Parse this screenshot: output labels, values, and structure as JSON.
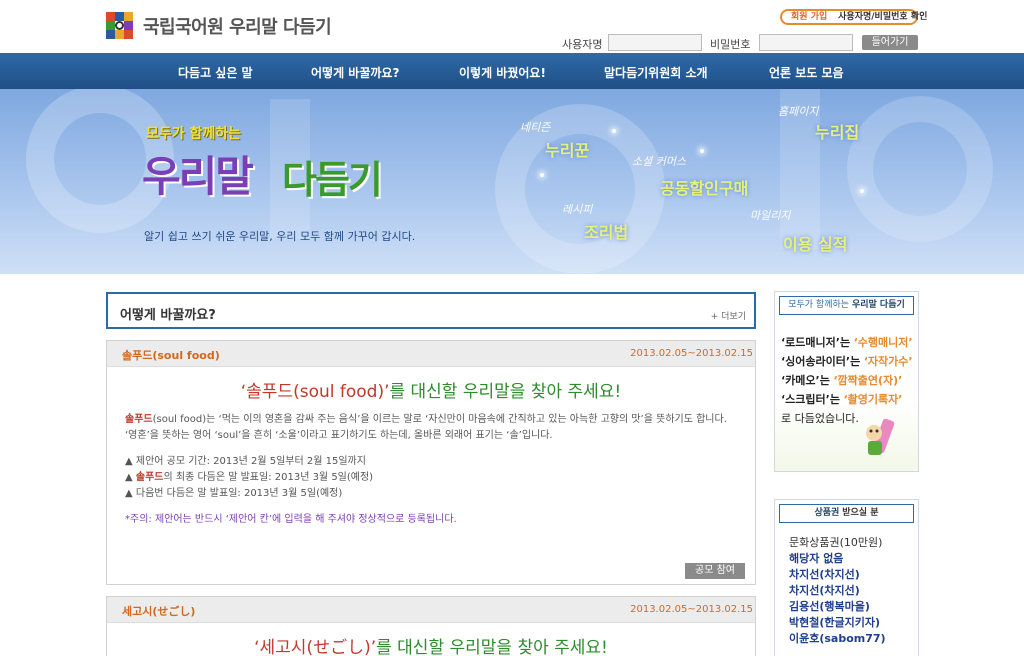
{
  "header": {
    "site_title": "국립국어원 우리말 다듬기",
    "member_join": "회원 가입",
    "find_account": "사용자명/비밀번호 확인",
    "username_label": "사용자명",
    "password_label": "비밀번호",
    "login_button": "들어가기"
  },
  "nav": {
    "items": [
      "다듬고 싶은 말",
      "어떻게 바꿀까요?",
      "이렇게 바꿨어요!",
      "말다듬기위원회 소개",
      "언론 보도 모음"
    ]
  },
  "banner": {
    "subtitle": "모두가 함께하는",
    "title_part1": "우리말",
    "title_part2": "다듬기",
    "slogan": "알기 쉽고 쓰기 쉬운 우리말, 우리 모두 함께 가꾸어 갑시다.",
    "keywords": [
      {
        "original": "네티즌",
        "replacement": "누리꾼"
      },
      {
        "original": "홈페이지",
        "replacement": "누리집"
      },
      {
        "original": "소셜 커머스",
        "replacement": "공동할인구매"
      },
      {
        "original": "레시피",
        "replacement": "조리법"
      },
      {
        "original": "마일리지",
        "replacement": "이용 실적"
      }
    ]
  },
  "section": {
    "title": "어떻게 바꿀까요?",
    "more": "+ 더보기"
  },
  "cards": [
    {
      "name": "솔푸드(soul food)",
      "date": "2013.02.05~2013.02.15",
      "headline_quoted": "‘솔푸드(soul food)’",
      "headline_rest": "를 대신할 우리말을 찾아 주세요!",
      "desc_term": "솔푸드",
      "desc_rest": "(soul food)는 ‘먹는 이의 영혼을 감싸 주는 음식’을 이르는 말로 ‘자신만이 마음속에 간직하고 있는 아늑한 고향의 맛’을 뜻하기도 합니다. ‘영혼’을 뜻하는 영어 ‘soul’을 흔히 ‘소울’이라고 표기하기도 하는데, 올바른 외래어 표기는 ‘솔’입니다.",
      "line1": "▲ 제안어 공모 기간: 2013년 2월 5일부터 2월 15일까지",
      "line2_prefix": "▲ ",
      "line2_term": "솔푸드",
      "line2_rest": "의 최종 다듬은 말 발표일: 2013년 3월 5일(예정)",
      "line3": "▲ 다음번 다듬은 말 발표일: 2013년 3월 5일(예정)",
      "notice": "*주의: 제안어는 반드시 ‘제안어 칸’에 입력을 해 주셔야 정상적으로 등록됩니다.",
      "button": "공모 참여"
    },
    {
      "name": "세고시(せごし)",
      "date": "2013.02.05~2013.02.15",
      "headline_quoted": "‘세고시(せごし)’",
      "headline_rest": "를 대신할 우리말을 찾아 주세요!"
    }
  ],
  "sidebar": {
    "promo_header_a": "모두가 함께하는",
    "promo_header_b": "우리말 다듬기",
    "promo_lines": [
      {
        "orig": "‘로드매니저’는",
        "new": "‘수행매니저’"
      },
      {
        "orig": "‘싱어송라이터’는",
        "new": "‘자작가수’"
      },
      {
        "orig": "‘카메오’는",
        "new": "‘깜짝출연(자)’"
      },
      {
        "orig": "‘스크립터’는",
        "new": "‘촬영기록자’"
      }
    ],
    "promo_end": "로 다듬었습니다.",
    "prize_header_a": "상품권",
    "prize_header_b": "받으실 분",
    "prize_first": "문화상품권(10만원)",
    "prize_names": [
      "해당자 없음",
      "차지선(차지선)",
      "차지선(차지선)",
      "김용선(행복마을)",
      "박현철(한글지키자)",
      "이윤호(sabom77)"
    ]
  },
  "colors": {
    "nav": "#2f6aa8",
    "accent_orange": "#e8892c",
    "headline_green": "#2e8b2e",
    "term_red": "#c0392b"
  }
}
